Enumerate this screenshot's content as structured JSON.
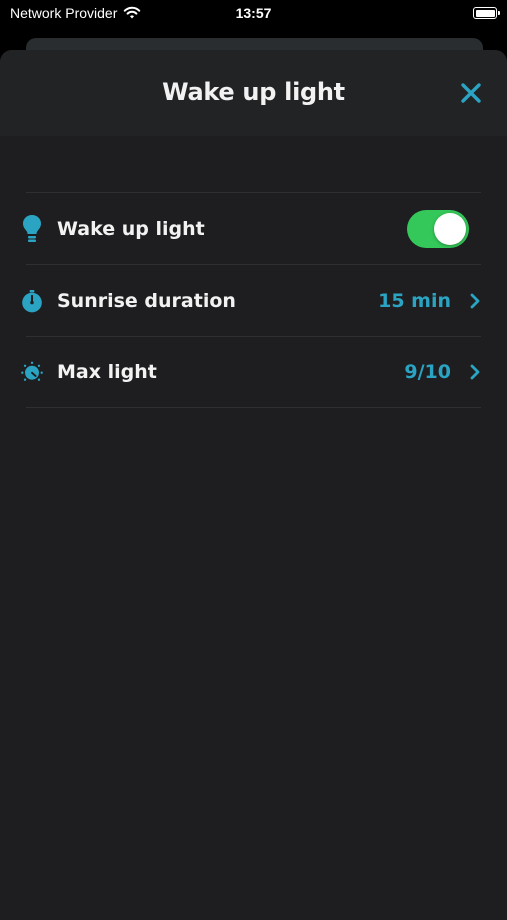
{
  "status_bar": {
    "carrier": "Network Provider",
    "time": "13:57",
    "icons": [
      "wifi-icon",
      "battery-icon"
    ]
  },
  "sheet": {
    "title": "Wake up light",
    "close_icon": "close-icon"
  },
  "settings": [
    {
      "label": "Wake up light",
      "icon": "lightbulb-icon",
      "control": "toggle",
      "enabled": true
    },
    {
      "label": "Sunrise duration",
      "icon": "stopwatch-icon",
      "value": "15 min",
      "chevron": "chevron-right-icon"
    },
    {
      "label": "Max light",
      "icon": "brightness-dial-icon",
      "value": "9/10",
      "chevron": "chevron-right-icon"
    }
  ],
  "colors": {
    "accent": "#2aa4c2",
    "toggle_on": "#34c759",
    "sheet_background": "#1e1e20",
    "header_background": "#222325"
  }
}
